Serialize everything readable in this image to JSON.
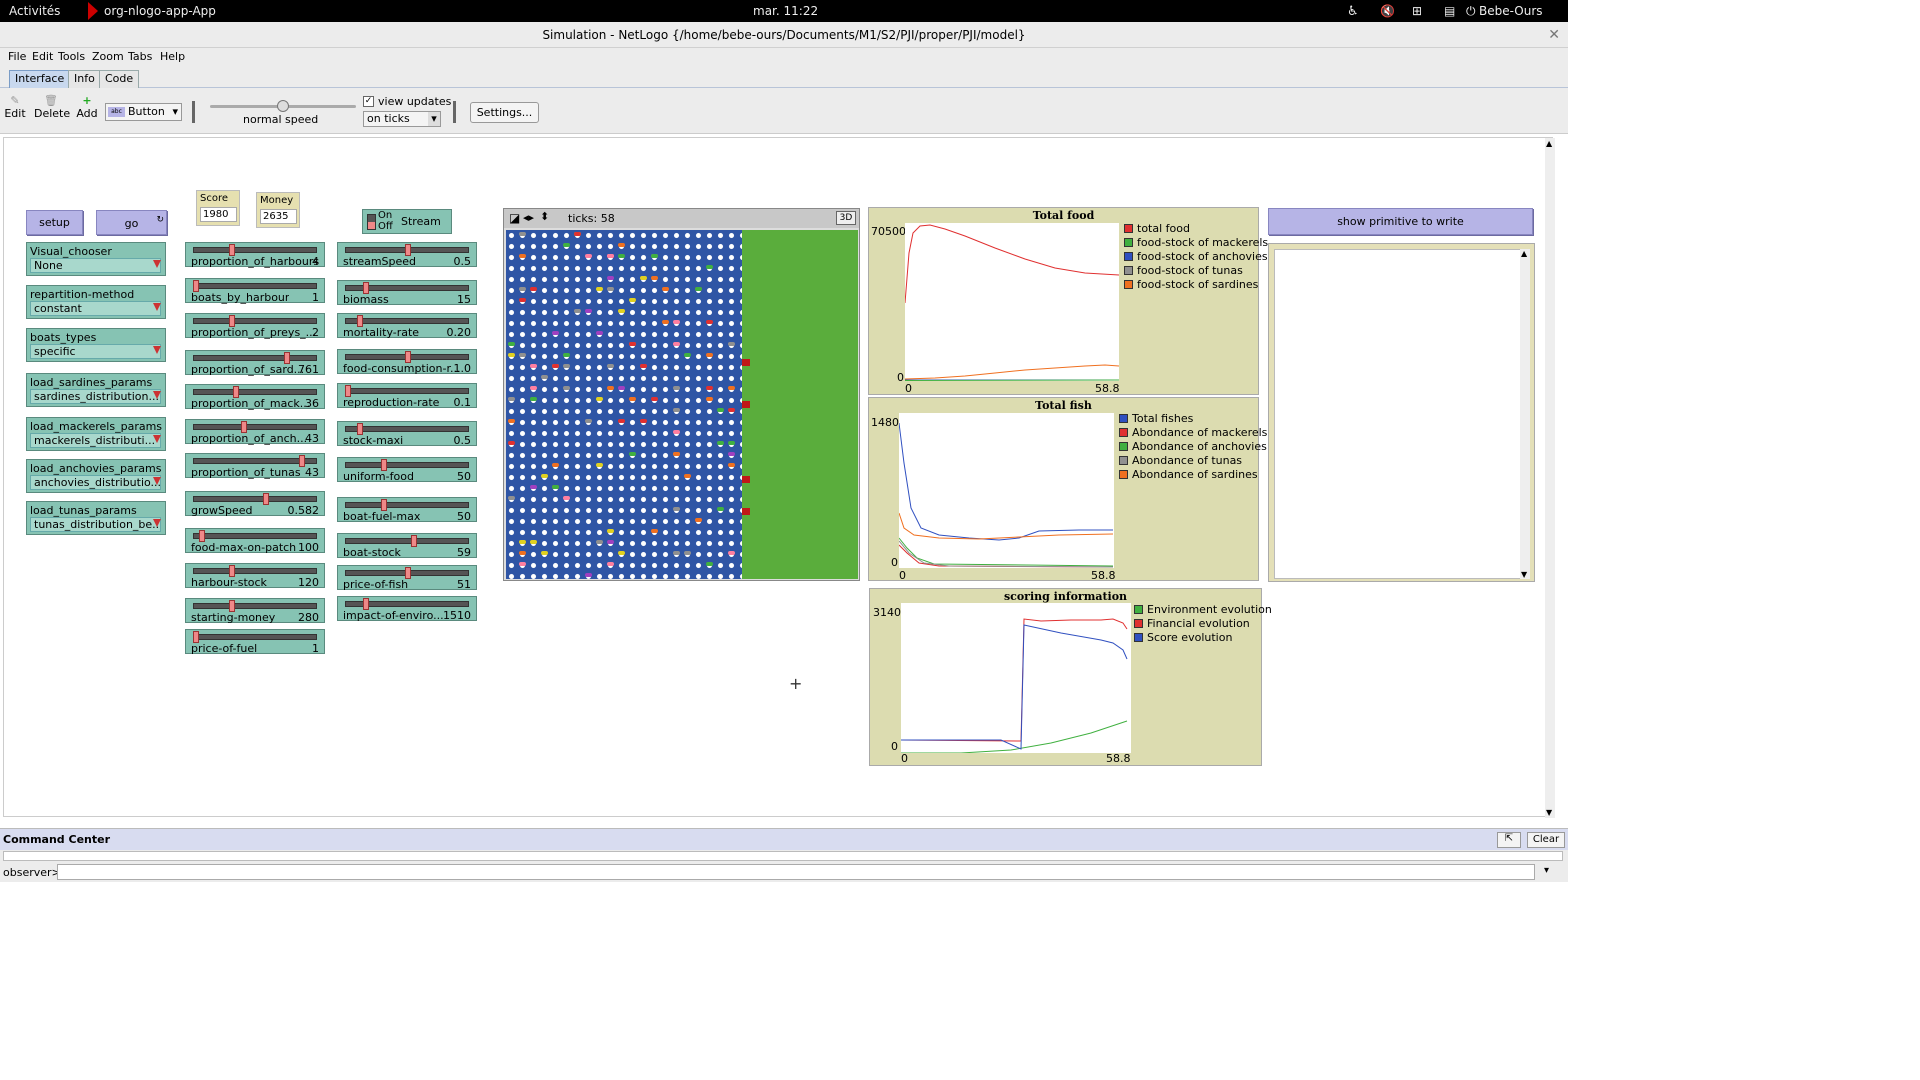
{
  "topbar": {
    "activities": "Activités",
    "app": "org-nlogo-app-App",
    "clock": "mar. 11:22",
    "user": "Bebe-Ours"
  },
  "window": {
    "title": "Simulation - NetLogo {/home/bebe-ours/Documents/M1/S2/PJI/proper/PJI/model}"
  },
  "menu": [
    "File",
    "Edit",
    "Tools",
    "Zoom",
    "Tabs",
    "Help"
  ],
  "tabs": [
    "Interface",
    "Info",
    "Code"
  ],
  "toolbar": {
    "edit": "Edit",
    "delete": "Delete",
    "add": "Add",
    "widget_type": "Button",
    "speed_label": "normal speed",
    "speed_value": 0.5,
    "view_updates": "view updates",
    "update_mode": "on ticks",
    "settings": "Settings..."
  },
  "buttons": {
    "setup": "setup",
    "go": "go",
    "stream_on": "On",
    "stream_off": "Off",
    "stream": "Stream",
    "show_primitive": "show primitive to write"
  },
  "monitors": [
    {
      "label": "Score",
      "value": "1980"
    },
    {
      "label": "Money",
      "value": "2635"
    }
  ],
  "choosers": [
    {
      "label": "Visual_chooser",
      "value": "None"
    },
    {
      "label": "repartition-method",
      "value": "constant"
    },
    {
      "label": "boats_types",
      "value": "specific"
    },
    {
      "label": "load_sardines_params",
      "value": "sardines_distribution..."
    },
    {
      "label": "load_mackerels_params",
      "value": "mackerels_distributi..."
    },
    {
      "label": "load_anchovies_params",
      "value": "anchovies_distributio..."
    },
    {
      "label": "load_tunas_params",
      "value": "tunas_distribution_be..."
    }
  ],
  "sliders_col1": [
    {
      "name": "proportion_of_harbours",
      "value": "4",
      "level": 0.3
    },
    {
      "name": "boats_by_harbour",
      "value": "1",
      "level": 0.0
    },
    {
      "name": "proportion_of_preys_...",
      "value": "2",
      "level": 0.3
    },
    {
      "name": "proportion_of_sard...",
      "value": "761",
      "level": 0.76
    },
    {
      "name": "proportion_of_mack...",
      "value": "36",
      "level": 0.33
    },
    {
      "name": "proportion_of_anch...",
      "value": "43",
      "level": 0.4
    },
    {
      "name": "proportion_of_tunas",
      "value": "43",
      "level": 0.88
    },
    {
      "name": "growSpeed",
      "value": "0.582",
      "level": 0.58
    },
    {
      "name": "food-max-on-patch",
      "value": "100",
      "level": 0.05
    },
    {
      "name": "harbour-stock",
      "value": "120",
      "level": 0.3
    },
    {
      "name": "starting-money",
      "value": "280",
      "level": 0.3
    },
    {
      "name": "price-of-fuel",
      "value": "1",
      "level": 0.0
    }
  ],
  "sliders_col2": [
    {
      "name": "streamSpeed",
      "value": "0.5",
      "level": 0.5
    },
    {
      "name": "biomass",
      "value": "15",
      "level": 0.15
    },
    {
      "name": "mortality-rate",
      "value": "0.20",
      "level": 0.1
    },
    {
      "name": "food-consumption-r...",
      "value": "1.0",
      "level": 0.5
    },
    {
      "name": "reproduction-rate",
      "value": "0.1",
      "level": 0.0
    },
    {
      "name": "stock-maxi",
      "value": "0.5",
      "level": 0.1
    },
    {
      "name": "uniform-food",
      "value": "50",
      "level": 0.3
    },
    {
      "name": "boat-fuel-max",
      "value": "50",
      "level": 0.3
    },
    {
      "name": "boat-stock",
      "value": "59",
      "level": 0.55
    },
    {
      "name": "price-of-fish",
      "value": "51",
      "level": 0.5
    },
    {
      "name": "impact-of-enviro...",
      "value": "1510",
      "level": 0.15
    }
  ],
  "view": {
    "ticks_label": "ticks: 58",
    "three_d": "3D"
  },
  "plots": {
    "food": {
      "title": "Total food",
      "ymax": "70500",
      "ymin": "0",
      "xmin": "0",
      "xmax": "58.8",
      "legend": [
        {
          "name": "total food",
          "color": "#e03030"
        },
        {
          "name": "food-stock of mackerels",
          "color": "#40b040"
        },
        {
          "name": "food-stock of anchovies",
          "color": "#3050c0"
        },
        {
          "name": "food-stock of tunas",
          "color": "#909090"
        },
        {
          "name": "food-stock of sardines",
          "color": "#f07020"
        }
      ]
    },
    "fish": {
      "title": "Total fish",
      "ymax": "1480",
      "ymin": "0",
      "xmin": "0",
      "xmax": "58.8",
      "legend": [
        {
          "name": "Total fishes",
          "color": "#3050c0"
        },
        {
          "name": "Abondance of mackerels",
          "color": "#e03030"
        },
        {
          "name": "Abondance of anchovies",
          "color": "#40b040"
        },
        {
          "name": "Abondance of tunas",
          "color": "#909090"
        },
        {
          "name": "Abondance of sardines",
          "color": "#f07020"
        }
      ]
    },
    "score": {
      "title": "scoring information",
      "ymax": "3140",
      "ymin": "0",
      "xmin": "0",
      "xmax": "58.8",
      "legend": [
        {
          "name": "Environment evolution",
          "color": "#40b040"
        },
        {
          "name": "Financial evolution",
          "color": "#e03030"
        },
        {
          "name": "Score evolution",
          "color": "#3050c0"
        }
      ]
    }
  },
  "command_center": {
    "title": "Command Center",
    "clear": "Clear",
    "prompt": "observer>"
  }
}
